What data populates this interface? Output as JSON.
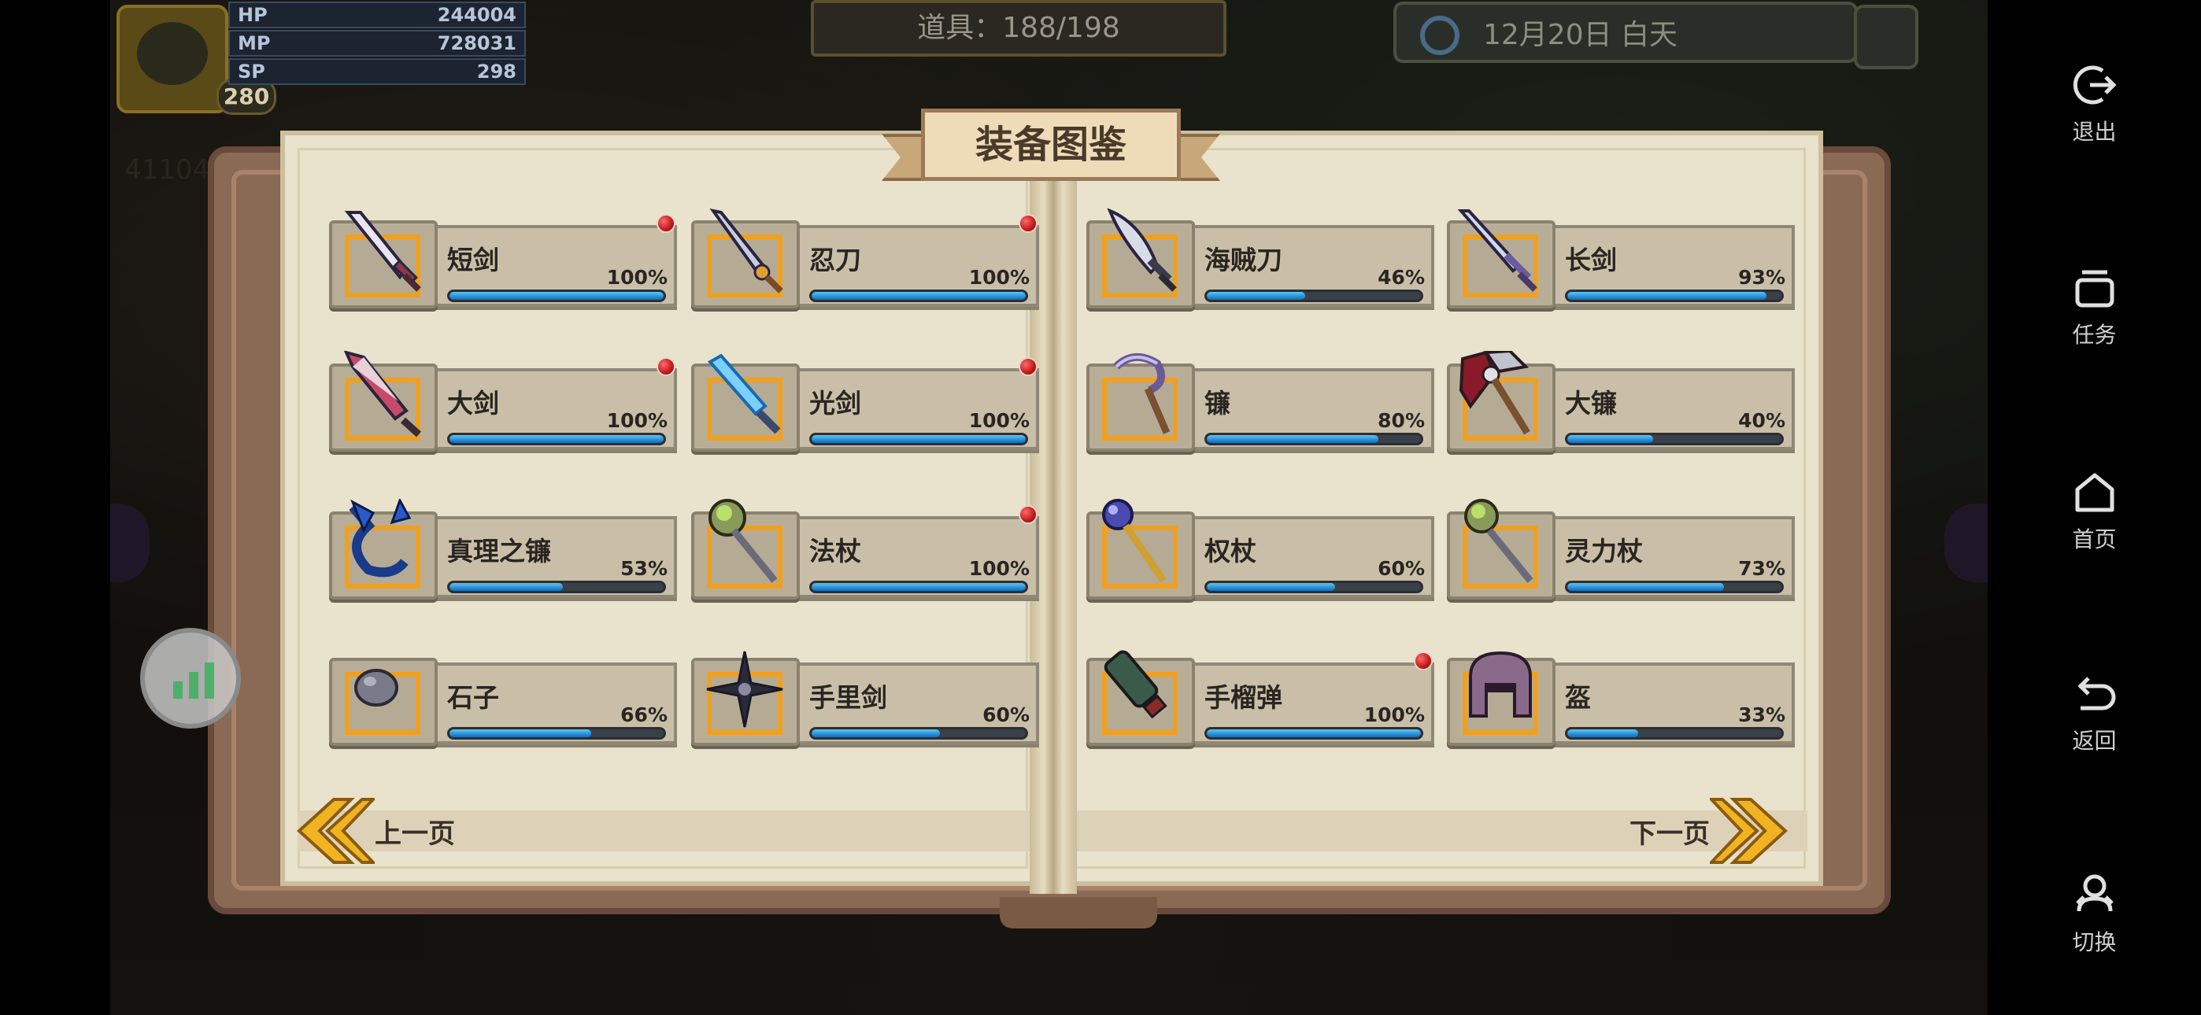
{
  "hud": {
    "stats": [
      {
        "key": "HP",
        "value": "244004"
      },
      {
        "key": "MP",
        "value": "728031"
      },
      {
        "key": "SP",
        "value": "298"
      }
    ],
    "level": "280",
    "items": "道具：188/198",
    "date": "12月20日 白天",
    "bg_left_number": "41104"
  },
  "book": {
    "title": "装备图鉴",
    "prev_label": "上一页",
    "next_label": "下一页",
    "items": [
      {
        "name": "短剑",
        "pct": "100%",
        "progress": 100,
        "dot": true,
        "icon": "dagger-icon"
      },
      {
        "name": "忍刀",
        "pct": "100%",
        "progress": 100,
        "dot": true,
        "icon": "ninja-blade-icon"
      },
      {
        "name": "海贼刀",
        "pct": "46%",
        "progress": 46,
        "dot": false,
        "icon": "pirate-sword-icon"
      },
      {
        "name": "长剑",
        "pct": "93%",
        "progress": 93,
        "dot": false,
        "icon": "longsword-icon"
      },
      {
        "name": "大剑",
        "pct": "100%",
        "progress": 100,
        "dot": true,
        "icon": "greatsword-icon"
      },
      {
        "name": "光剑",
        "pct": "100%",
        "progress": 100,
        "dot": true,
        "icon": "lightsaber-icon"
      },
      {
        "name": "镰",
        "pct": "80%",
        "progress": 80,
        "dot": false,
        "icon": "sickle-icon"
      },
      {
        "name": "大镰",
        "pct": "40%",
        "progress": 40,
        "dot": false,
        "icon": "great-scythe-icon"
      },
      {
        "name": "真理之镰",
        "pct": "53%",
        "progress": 53,
        "dot": false,
        "icon": "truth-scythe-icon"
      },
      {
        "name": "法杖",
        "pct": "100%",
        "progress": 100,
        "dot": true,
        "icon": "magic-staff-icon"
      },
      {
        "name": "权杖",
        "pct": "60%",
        "progress": 60,
        "dot": false,
        "icon": "scepter-icon"
      },
      {
        "name": "灵力杖",
        "pct": "73%",
        "progress": 73,
        "dot": false,
        "icon": "spirit-staff-icon"
      },
      {
        "name": "石子",
        "pct": "66%",
        "progress": 66,
        "dot": false,
        "icon": "stone-icon"
      },
      {
        "name": "手里剑",
        "pct": "60%",
        "progress": 60,
        "dot": false,
        "icon": "shuriken-icon"
      },
      {
        "name": "手榴弹",
        "pct": "100%",
        "progress": 100,
        "dot": true,
        "icon": "grenade-icon"
      },
      {
        "name": "盔",
        "pct": "33%",
        "progress": 33,
        "dot": false,
        "icon": "helmet-icon"
      }
    ]
  },
  "sysnav": {
    "exit": "退出",
    "tasks": "任务",
    "home": "首页",
    "back": "返回",
    "switch": "切换"
  },
  "colors": {
    "accent_orange": "#f0a020",
    "bar_blue": "#2a8ed8",
    "red_dot": "#c01818"
  }
}
